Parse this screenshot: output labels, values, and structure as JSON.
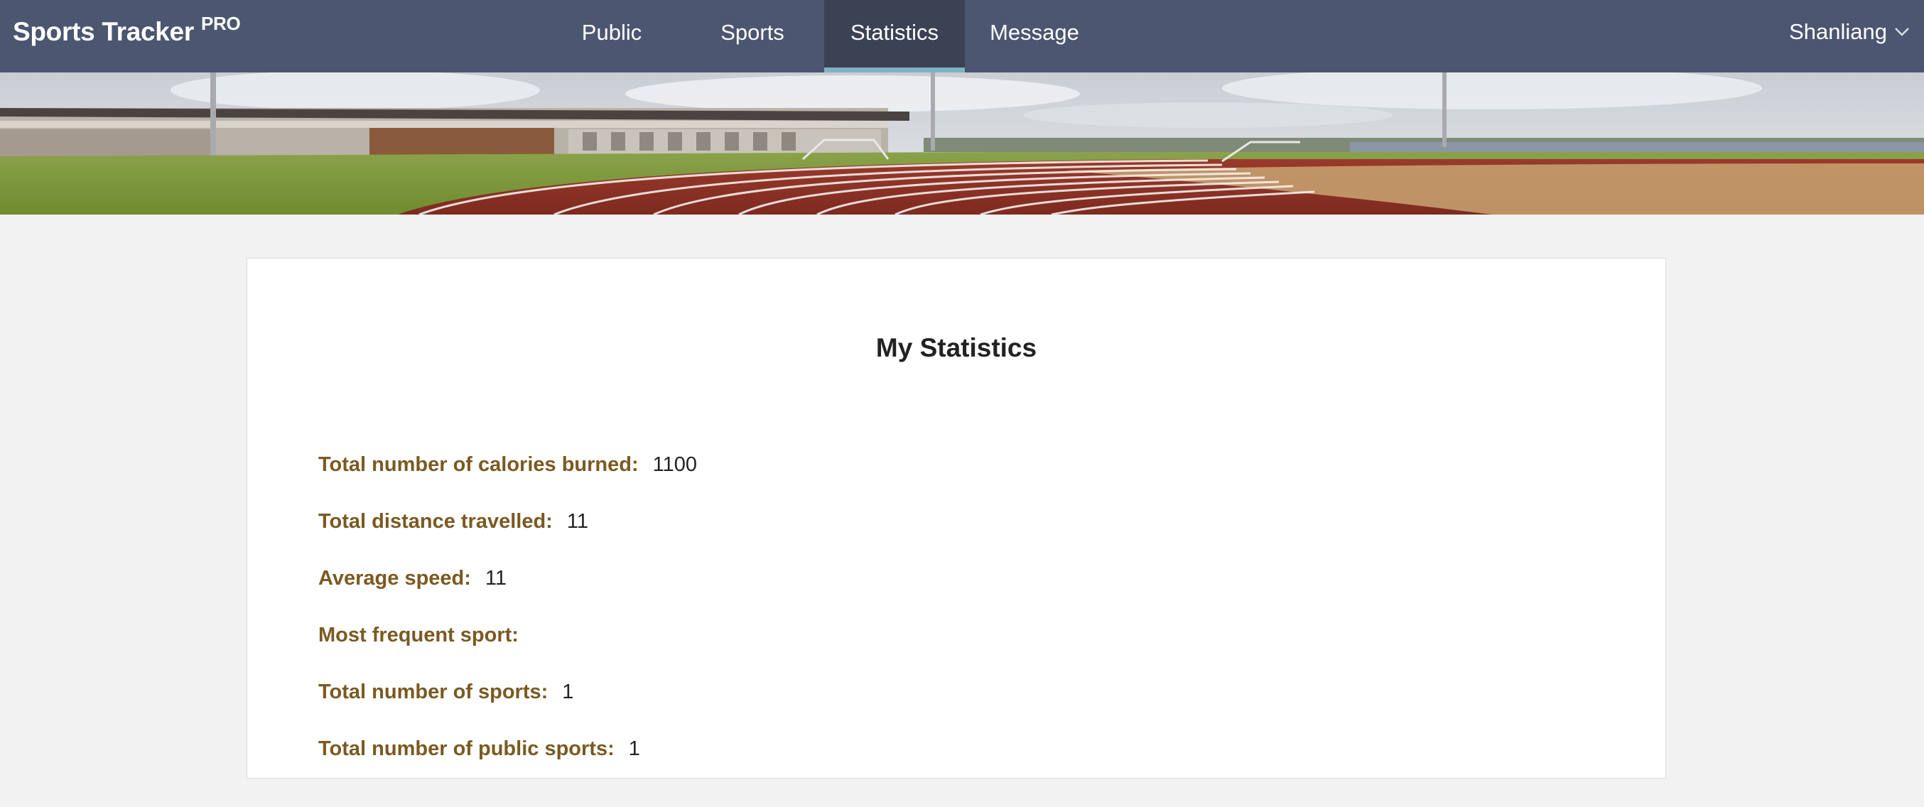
{
  "navbar": {
    "brand": "Sports Tracker",
    "brand_badge": "PRO",
    "tabs": [
      {
        "label": "Public",
        "active": false
      },
      {
        "label": "Sports",
        "active": false
      },
      {
        "label": "Statistics",
        "active": true
      },
      {
        "label": "Message",
        "active": false
      }
    ],
    "user": {
      "name": "Shanliang",
      "icon": "chevron-down-icon"
    },
    "colors": {
      "bar": "#4b5670",
      "active_tab": "#3a4254",
      "active_indicator": "#7fb3c2"
    }
  },
  "hero": {
    "subject": "athletics running track with stadium stand"
  },
  "statistics": {
    "title": "My Statistics",
    "rows": [
      {
        "label": "Total number of calories burned:",
        "value": "1100"
      },
      {
        "label": "Total distance travelled:",
        "value": "11"
      },
      {
        "label": "Average speed:",
        "value": "11"
      },
      {
        "label": "Most frequent sport:",
        "value": ""
      },
      {
        "label": "Total number of sports:",
        "value": "1"
      },
      {
        "label": "Total number of public sports:",
        "value": "1"
      }
    ],
    "colors": {
      "label": "#7a5a22"
    }
  }
}
